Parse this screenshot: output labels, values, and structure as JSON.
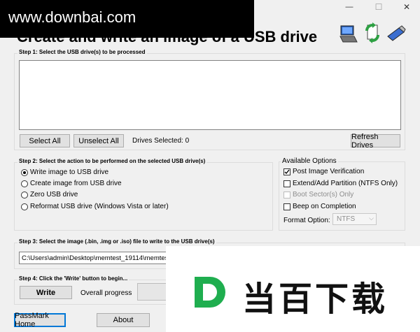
{
  "watermark_top": "www.downbai.com",
  "window_controls": {
    "minimize": "—",
    "maximize": "☐",
    "close": "✕"
  },
  "title": "Create and write an image of a USB drive",
  "step1": {
    "label": "Step 1:  Select the USB drive(s) to be processed",
    "select_all": "Select All",
    "unselect_all": "Unselect All",
    "drives_selected": "Drives Selected: 0",
    "refresh": "Refresh Drives"
  },
  "step2": {
    "label": "Step 2: Select the action to be performed on the selected USB drive(s)",
    "options": [
      "Write image to USB drive",
      "Create image from USB drive",
      "Zero USB drive",
      "Reformat USB drive (Windows Vista or later)"
    ],
    "selected_index": 0
  },
  "available_options": {
    "label": "Available Options",
    "post_image_verification": "Post Image Verification",
    "extend_partition": "Extend/Add Partition (NTFS Only)",
    "boot_sectors_only": "Boot Sector(s) Only",
    "beep_on_completion": "Beep on Completion",
    "format_option_label": "Format Option:",
    "format_value": "NTFS"
  },
  "step3": {
    "label": "Step 3: Select the image (.bin, .img or .iso) file to write to the USB drive(s)",
    "path": "C:\\Users\\admin\\Desktop\\memtest_19114\\memtest"
  },
  "step4": {
    "label": "Step 4: Click the 'Write' button to begin...",
    "write": "Write",
    "overall_progress": "Overall progress"
  },
  "footer": {
    "passmark_home": "PassMark Home",
    "about": "About"
  },
  "watermark_bottom": "当百下载",
  "watermark_logo_letter": "D",
  "colors": {
    "accent": "#0078d7",
    "watermark_green": "#1fae4f"
  }
}
